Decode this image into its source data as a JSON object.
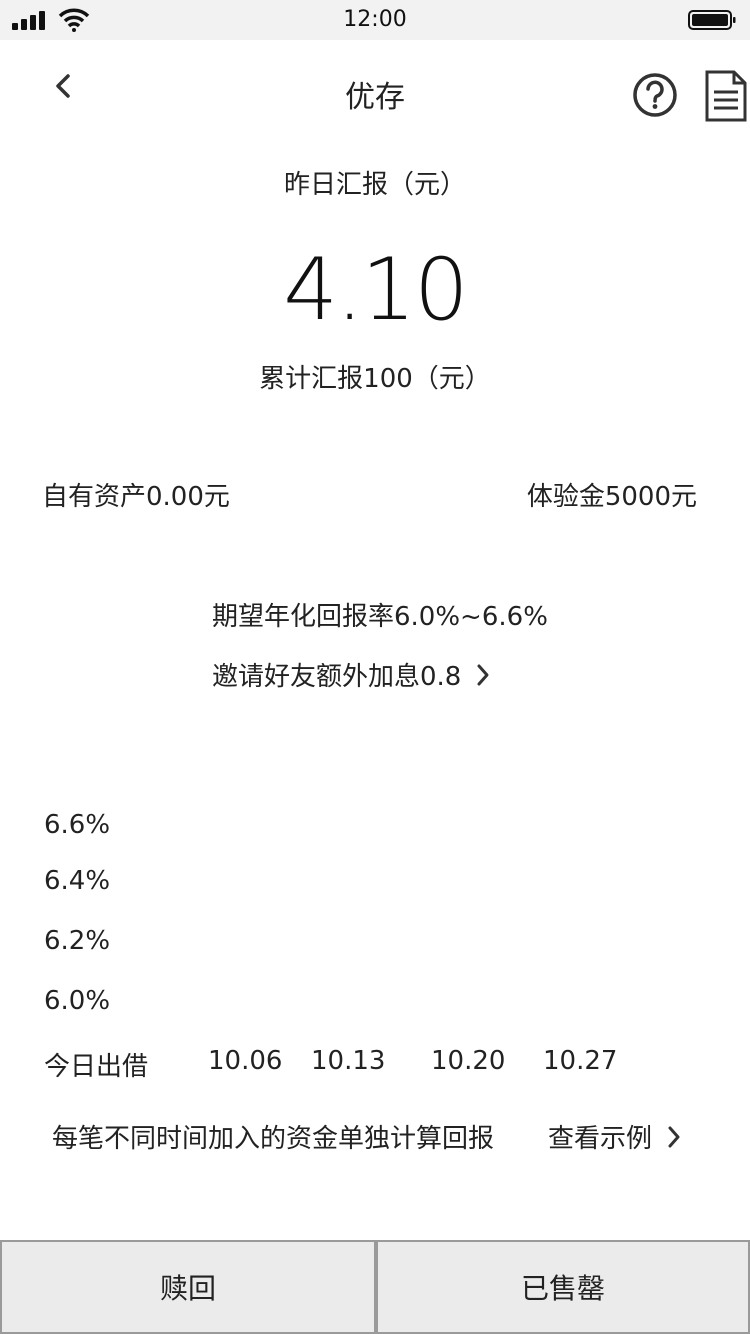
{
  "status_bar": {
    "time": "12:00"
  },
  "nav": {
    "title": "优存",
    "icons": [
      "back-icon",
      "help-icon",
      "document-icon"
    ]
  },
  "summary": {
    "yesterday_label": "昨日汇报（元）",
    "yesterday_value": "4.10",
    "cumulative_label": "累计汇报100（元）"
  },
  "assets": {
    "own": "自有资产0.00元",
    "trial": "体验金5000元"
  },
  "promo": {
    "expected_rate": "期望年化回报率6.0%~6.6%",
    "invite": "邀请好友额外加息0.8"
  },
  "chart_data": {
    "type": "line",
    "y_ticks": [
      "6.6%",
      "6.4%",
      "6.2%",
      "6.0%"
    ],
    "x_ticks": [
      "今日出借",
      "10.06",
      "10.13",
      "10.20",
      "10.27"
    ]
  },
  "footer": {
    "note": "每笔不同时间加入的资金单独计算回报",
    "example": "查看示例"
  },
  "actions": {
    "redeem": "赎回",
    "sold_out": "已售罄"
  }
}
